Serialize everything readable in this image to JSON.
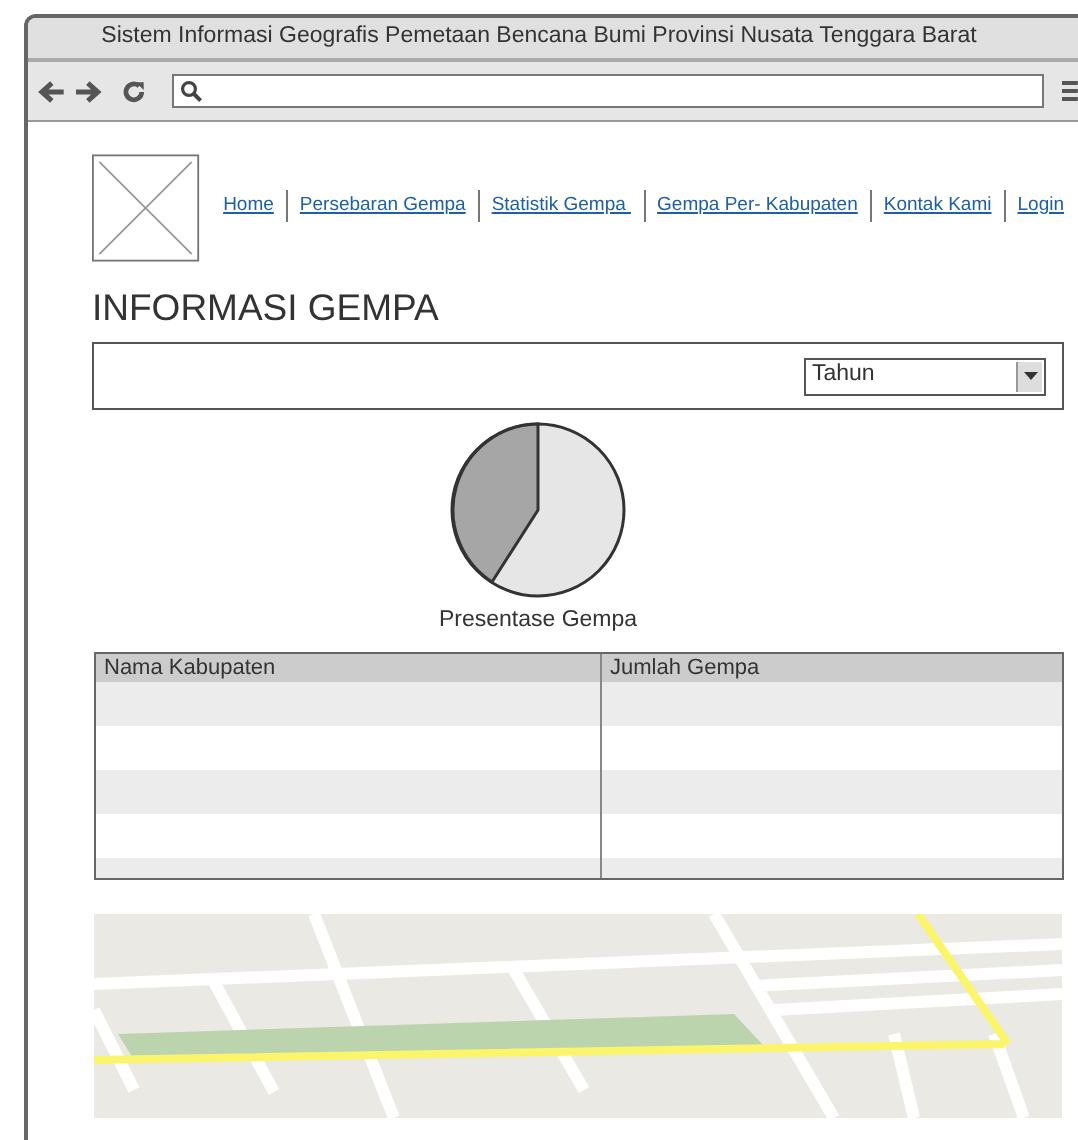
{
  "window": {
    "title": "Sistem Informasi Geografis Pemetaan Bencana Bumi Provinsi Nusata Tenggara Barat"
  },
  "nav": {
    "links": [
      "Home",
      "Persebaran Gempa",
      "Statistik Gempa ",
      "Gempa Per- Kabupaten",
      "Kontak Kami",
      "Login"
    ]
  },
  "heading": "INFORMASI GEMPA",
  "filter": {
    "dropdown": {
      "value": "Tahun"
    }
  },
  "chart": {
    "caption": "Presentase Gempa"
  },
  "table": {
    "columns": [
      "Nama Kabupaten",
      "Jumlah Gempa"
    ]
  }
}
